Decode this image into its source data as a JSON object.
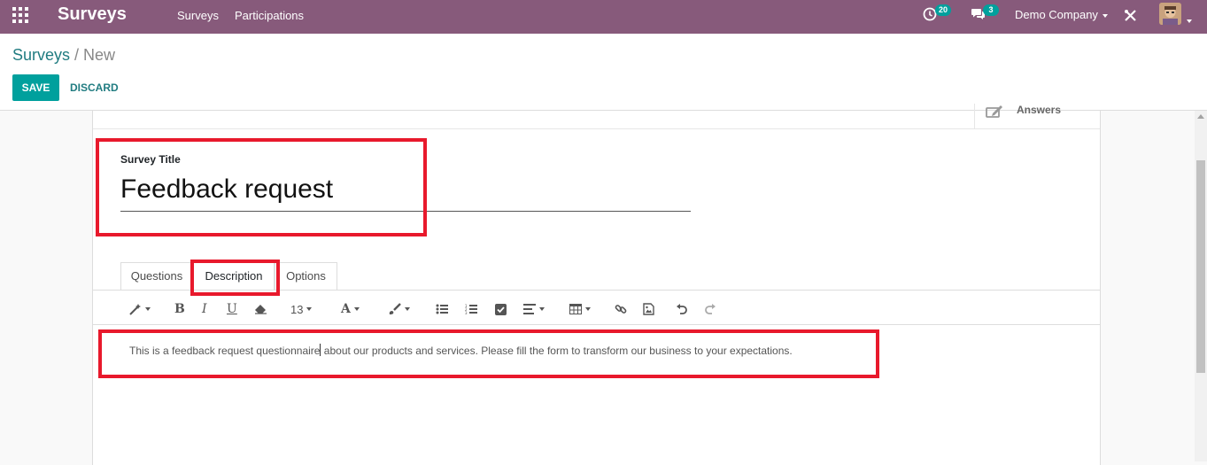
{
  "navbar": {
    "apps_icon": "grid-icon",
    "app_name": "Surveys",
    "menu": [
      "Surveys",
      "Participations"
    ],
    "activity_badge": "20",
    "messages_badge": "3",
    "company": "Demo Company"
  },
  "breadcrumb": {
    "parent": "Surveys",
    "separator": "/",
    "current": "New"
  },
  "actions": {
    "save": "SAVE",
    "discard": "DISCARD"
  },
  "stat_button": {
    "label": "Answers",
    "icon": "edit-icon"
  },
  "form": {
    "title_label": "Survey Title",
    "title_value": "Feedback request",
    "tabs": [
      "Questions",
      "Description",
      "Options"
    ],
    "active_tab": "Description",
    "font_size": "13",
    "description_before_cursor": "This is a feedback request questionnaire",
    "description_after_cursor": " about our products and services. Please fill the form to transform our business to your expectations."
  },
  "colors": {
    "navbar": "#875a7b",
    "primary": "#00a09d",
    "link": "#217c81",
    "highlight": "#e8192c"
  }
}
